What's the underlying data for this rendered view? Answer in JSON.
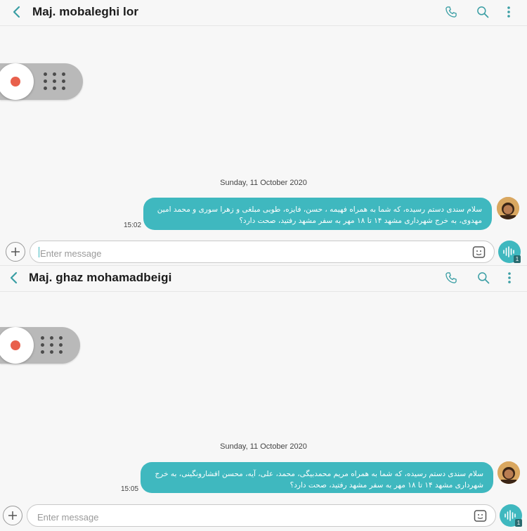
{
  "conversations": [
    {
      "contact_name": "Maj. mobaleghi lor",
      "date_divider": "Sunday, 11 October 2020",
      "message": {
        "text": "سلام سندی دستم رسیده، که شما به همراه فهیمه ، حسن، فایزه، طوبی مبلغی و زهرا سوری و محمد امین مهدوی، به خرج شهرداری مشهد ۱۴ تا ۱۸ مهر به سفر مشهد رفتید، صحت دارد؟",
        "time": "15:02"
      },
      "input_placeholder": "Enter message",
      "voice_badge": "1"
    },
    {
      "contact_name": "Maj. ghaz mohamadbeigi",
      "date_divider": "Sunday, 11 October 2020",
      "message": {
        "text": "سلام سندی دستم رسیده، که شما به همراه مریم محمدبیگی، محمد، علی، آیه، محسن افشارونگینی، به خرج شهرداری مشهد ۱۴ تا ۱۸ مهر به سفر مشهد رفتید، صحت دارد؟",
        "time": "15:05"
      },
      "input_placeholder": "Enter message",
      "voice_badge": "1"
    }
  ],
  "icons": {
    "back": "chevron-left-icon",
    "call": "phone-icon",
    "search": "search-icon",
    "more": "more-vertical-icon",
    "record": "record-icon",
    "drag": "grid-dots-icon",
    "add": "plus-icon",
    "sticker": "sticker-icon",
    "voice": "voice-wave-icon"
  },
  "colors": {
    "accent": "#3fb8bf",
    "record_dot": "#e8604c",
    "background": "#f7f7f7"
  }
}
